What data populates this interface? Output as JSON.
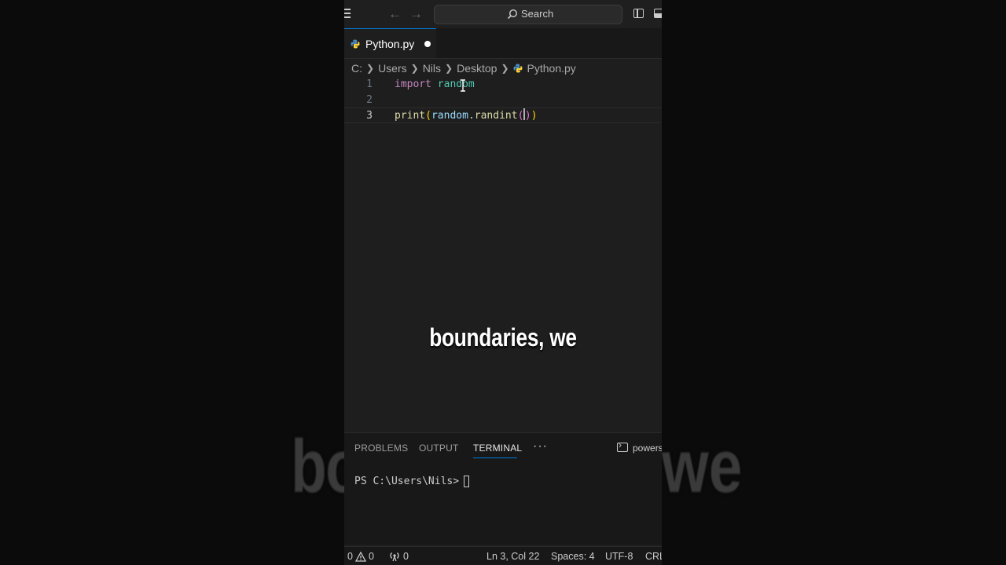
{
  "background_caption": {
    "left": "bo",
    "right": "we"
  },
  "titlebar": {
    "search_label": "Search",
    "icons": [
      "menu-icon",
      "arrow-left-icon",
      "arrow-right-icon",
      "search-icon",
      "toggle-sidebar-icon",
      "toggle-panel-icon"
    ]
  },
  "tabs": [
    {
      "label": "Python.py",
      "modified": true,
      "icon": "python-file-icon"
    }
  ],
  "breadcrumb": {
    "items": [
      "C:",
      "Users",
      "Nils",
      "Desktop"
    ],
    "file": "Python.py"
  },
  "editor": {
    "line_numbers": [
      "1",
      "2",
      "3"
    ],
    "current_line": "3",
    "line1": {
      "keyword": "import",
      "module": "random"
    },
    "line3": {
      "func": "print",
      "open_paren": "(",
      "obj": "random",
      "dot": ".",
      "method": "randint",
      "inner_open": "(",
      "inner_close": ")",
      "close_paren": ")"
    }
  },
  "caption": "boundaries, we",
  "panel": {
    "tabs": [
      "PROBLEMS",
      "OUTPUT",
      "TERMINAL"
    ],
    "active_tab": "TERMINAL",
    "more": "···",
    "shell_label": "powers",
    "terminal_prompt": "PS C:\\Users\\Nils>"
  },
  "statusbar": {
    "errors": "0",
    "warnings": "0",
    "ports": "0",
    "position": "Ln 3, Col 22",
    "spaces": "Spaces: 4",
    "encoding": "UTF-8",
    "eol": "CRL"
  },
  "colors": {
    "accent": "#0078d4",
    "keyword": "#c586c0",
    "module": "#4ec9b0",
    "function": "#dcdcaa",
    "variable": "#9cdcfe",
    "bracket1": "#ffd700",
    "bracket2": "#da70d6"
  }
}
